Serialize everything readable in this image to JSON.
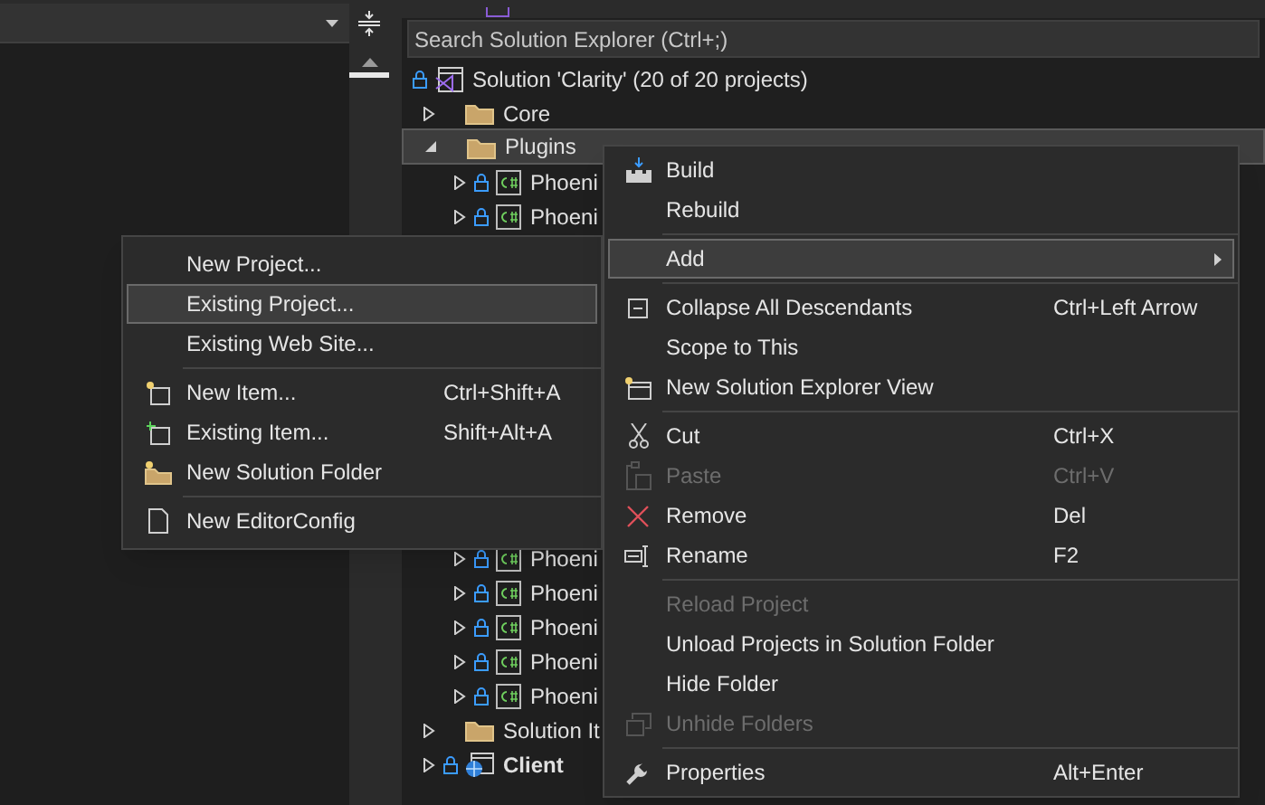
{
  "search": {
    "placeholder": "Search Solution Explorer (Ctrl+;)"
  },
  "tree": {
    "label": "Solution 'Clarity' (20 of 20 projects)",
    "kind": "solution",
    "locked": true,
    "children": [
      {
        "label": "Core",
        "kind": "folder",
        "expanded": false,
        "locked": false,
        "selected": false
      },
      {
        "label": "Plugins",
        "kind": "folder",
        "expanded": true,
        "locked": false,
        "selected": true,
        "children": [
          {
            "label": "Phoeni",
            "kind": "csharp",
            "expanded": false,
            "locked": true,
            "selected": false
          },
          {
            "label": "Phoeni",
            "kind": "csharp",
            "expanded": false,
            "locked": true,
            "selected": false
          },
          {
            "label": "Phoeni",
            "kind": "csharp",
            "expanded": false,
            "locked": true,
            "selected": false
          },
          {
            "label": "Phoeni",
            "kind": "csharp",
            "expanded": false,
            "locked": true,
            "selected": false
          },
          {
            "label": "Phoeni",
            "kind": "csharp",
            "expanded": false,
            "locked": true,
            "selected": false
          },
          {
            "label": "Phoeni",
            "kind": "csharp",
            "expanded": false,
            "locked": true,
            "selected": false
          },
          {
            "label": "Phoeni",
            "kind": "csharp",
            "expanded": false,
            "locked": true,
            "selected": false
          }
        ]
      },
      {
        "label": "Solution It",
        "kind": "folder",
        "expanded": false,
        "locked": false,
        "selected": false
      },
      {
        "label": "Client",
        "kind": "web",
        "expanded": false,
        "locked": true,
        "selected": false,
        "startup": true
      }
    ]
  },
  "context_menu": [
    {
      "kind": "item",
      "label": "Build",
      "disabled": false,
      "selected": false
    },
    {
      "kind": "item",
      "label": "Rebuild",
      "disabled": false,
      "selected": false
    },
    {
      "kind": "separator"
    },
    {
      "kind": "item",
      "label": "Add",
      "disabled": false,
      "selected": true,
      "submenu": true
    },
    {
      "kind": "separator"
    },
    {
      "kind": "item",
      "label": "Collapse All Descendants",
      "shortcut": "Ctrl+Left Arrow",
      "disabled": false,
      "selected": false
    },
    {
      "kind": "item",
      "label": "Scope to This",
      "disabled": false,
      "selected": false
    },
    {
      "kind": "item",
      "label": "New Solution Explorer View",
      "disabled": false,
      "selected": false
    },
    {
      "kind": "separator"
    },
    {
      "kind": "item",
      "label": "Cut",
      "shortcut": "Ctrl+X",
      "disabled": false,
      "selected": false
    },
    {
      "kind": "item",
      "label": "Paste",
      "shortcut": "Ctrl+V",
      "disabled": true,
      "selected": false
    },
    {
      "kind": "item",
      "label": "Remove",
      "shortcut": "Del",
      "disabled": false,
      "selected": false
    },
    {
      "kind": "item",
      "label": "Rename",
      "shortcut": "F2",
      "disabled": false,
      "selected": false
    },
    {
      "kind": "separator"
    },
    {
      "kind": "item",
      "label": "Reload Project",
      "disabled": true,
      "selected": false
    },
    {
      "kind": "item",
      "label": "Unload Projects in Solution Folder",
      "disabled": false,
      "selected": false
    },
    {
      "kind": "item",
      "label": "Hide Folder",
      "disabled": false,
      "selected": false
    },
    {
      "kind": "item",
      "label": "Unhide Folders",
      "disabled": true,
      "selected": false
    },
    {
      "kind": "separator"
    },
    {
      "kind": "item",
      "label": "Properties",
      "shortcut": "Alt+Enter",
      "disabled": false,
      "selected": false
    }
  ],
  "add_submenu": [
    {
      "kind": "item",
      "label": "New Project...",
      "disabled": false,
      "selected": false
    },
    {
      "kind": "item",
      "label": "Existing Project...",
      "disabled": false,
      "selected": true
    },
    {
      "kind": "item",
      "label": "Existing Web Site...",
      "disabled": false,
      "selected": false
    },
    {
      "kind": "separator"
    },
    {
      "kind": "item",
      "label": "New Item...",
      "shortcut": "Ctrl+Shift+A",
      "disabled": false,
      "selected": false
    },
    {
      "kind": "item",
      "label": "Existing Item...",
      "shortcut": "Shift+Alt+A",
      "disabled": false,
      "selected": false
    },
    {
      "kind": "item",
      "label": "New Solution Folder",
      "disabled": false,
      "selected": false
    },
    {
      "kind": "separator"
    },
    {
      "kind": "item",
      "label": "New EditorConfig",
      "disabled": false,
      "selected": false
    }
  ]
}
